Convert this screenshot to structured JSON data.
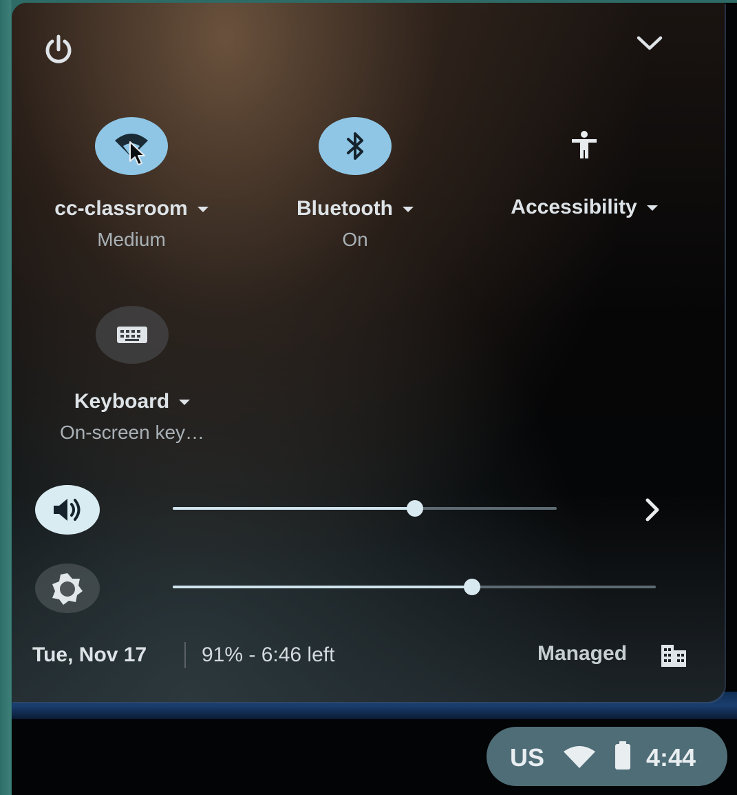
{
  "quick_settings": {
    "tiles": [
      {
        "label": "cc-classroom",
        "sublabel": "Medium",
        "icon": "wifi-icon",
        "state": "on"
      },
      {
        "label": "Bluetooth",
        "sublabel": "On",
        "icon": "bluetooth-icon",
        "state": "on"
      },
      {
        "label": "Accessibility",
        "sublabel": "",
        "icon": "accessibility-icon",
        "state": "off"
      },
      {
        "label": "Keyboard",
        "sublabel": "On-screen key…",
        "icon": "keyboard-icon",
        "state": "off"
      }
    ],
    "volume": {
      "icon": "volume-icon",
      "level": 0.63
    },
    "brightness": {
      "icon": "brightness-icon",
      "level": 0.62
    },
    "footer": {
      "date": "Tue, Nov 17",
      "battery": "91% - 6:46 left",
      "managed": "Managed"
    }
  },
  "status_area": {
    "language": "US",
    "time": "4:44"
  },
  "colors": {
    "tile_on": "#8fc6e6",
    "accent": "#cfe3ec",
    "status_pill": "#4f6d77"
  }
}
